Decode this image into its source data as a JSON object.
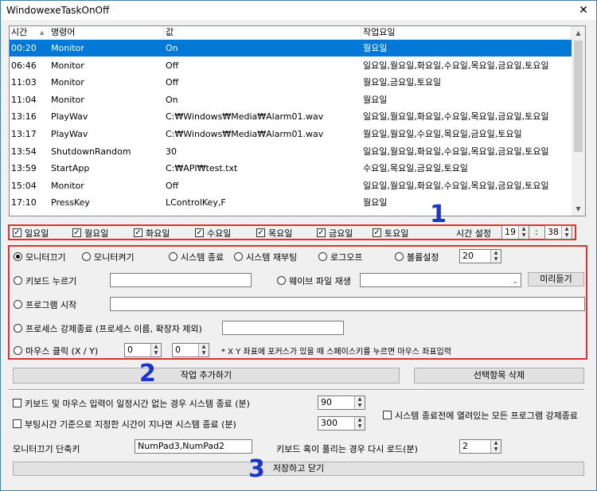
{
  "window": {
    "title": "WindowexeTaskOnOff",
    "close": "✕"
  },
  "list": {
    "headers": [
      "시간",
      "명령어",
      "값",
      "작업요일"
    ],
    "sort_indicator": "▲",
    "rows": [
      {
        "time": "00:20",
        "cmd": "Monitor",
        "value": "On",
        "days": "월요일",
        "selected": true
      },
      {
        "time": "06:46",
        "cmd": "Monitor",
        "value": "Off",
        "days": "일요일,월요일,화요일,수요일,목요일,금요일,토요일"
      },
      {
        "time": "11:03",
        "cmd": "Monitor",
        "value": "Off",
        "days": "월요일,금요일,토요일"
      },
      {
        "time": "11:04",
        "cmd": "Monitor",
        "value": "On",
        "days": "월요일"
      },
      {
        "time": "13:16",
        "cmd": "PlayWav",
        "value": "C:₩Windows₩Media₩Alarm01.wav",
        "days": "일요일,월요일,화요일,수요일,목요일,금요일,토요일"
      },
      {
        "time": "13:17",
        "cmd": "PlayWav",
        "value": "C:₩Windows₩Media₩Alarm01.wav",
        "days": "월요일,월요일,수요일,목요일,금요일,토요일"
      },
      {
        "time": "13:54",
        "cmd": "ShutdownRandom",
        "value": "30",
        "days": "일요일,월요일,화요일,수요일,목요일,금요일,토요일"
      },
      {
        "time": "13:59",
        "cmd": "StartApp",
        "value": "C:₩API₩test.txt",
        "days": "수요일,목요일,금요일,토요일"
      },
      {
        "time": "15:04",
        "cmd": "Monitor",
        "value": "Off",
        "days": "일요일,월요일,화요일,수요일,목요일,금요일,토요일"
      },
      {
        "time": "17:10",
        "cmd": "PressKey",
        "value": "LControlKey,F",
        "days": "월요일"
      },
      {
        "time": "",
        "cmd": "",
        "value": "",
        "days": ""
      }
    ]
  },
  "days": {
    "items": [
      "일요일",
      "월요일",
      "화요일",
      "수요일",
      "목요일",
      "금요일",
      "토요일"
    ],
    "time_label": "시간 설정",
    "hour": "19",
    "colon": ":",
    "minute": "38"
  },
  "commands": {
    "monitor_off": "모니터끄기",
    "monitor_on": "모니터켜기",
    "sys_shutdown": "시스템 종료",
    "sys_reboot": "시스템 재부팅",
    "logoff": "로그오프",
    "volume": "볼륨설정",
    "volume_value": "20",
    "keyboard": "키보드 누르기",
    "keyboard_value": "",
    "wave": "웨이브 파일 재생",
    "wave_value": "",
    "preview": "미리듣기",
    "program": "프로그램 시작",
    "program_value": "",
    "kill": "프로세스 강제종료 (프로세스 이름, 확장자 제외)",
    "kill_value": "",
    "mouse": "마우스 클릭 (X / Y)",
    "mouse_x": "0",
    "mouse_y": "0",
    "mouse_note": "* X Y 좌표에 포커스가 있을 때 스페이스키를 누르면 마우스 좌표입력"
  },
  "actions": {
    "add": "작업 추가하기",
    "delete": "선택항목 삭제"
  },
  "options": {
    "idle_shutdown": "키보드 및 마우스 입력이 일정시간 없는 경우 시스템 종료 (분)",
    "idle_value": "90",
    "boot_shutdown": "부팅시간 기준으로 지정한 시간이 지나면 시스템 종료 (분)",
    "boot_value": "300",
    "force_close": "시스템 종료전에 열려있는 모든 프로그램 강제종료",
    "hotkey_label": "모니터끄기 단축키",
    "hotkey_value": "NumPad3,NumPad2",
    "reload_label": "키보드 혹이 풀리는 경우 다시 로드(분)",
    "reload_value": "2"
  },
  "save": "저장하고 닫기",
  "markers": {
    "one": "1",
    "two": "2",
    "three": "3"
  },
  "colors": {
    "selection": "#0078d7",
    "annotation_red": "#e03030",
    "annotation_blue": "#1a36c8"
  }
}
